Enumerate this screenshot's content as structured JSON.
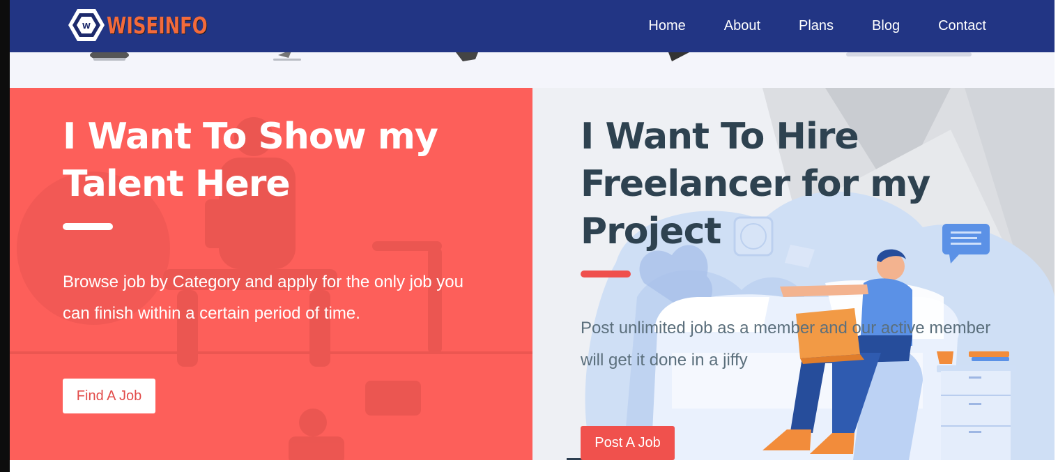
{
  "brand": {
    "logo_text": "WISEINFO",
    "accent_color": "#f36a3b",
    "header_color": "#223584"
  },
  "nav": {
    "items": [
      {
        "label": "Home"
      },
      {
        "label": "About"
      },
      {
        "label": "Plans"
      },
      {
        "label": "Blog"
      },
      {
        "label": "Contact"
      }
    ]
  },
  "talent": {
    "heading": "I Want To Show my Talent Here",
    "description": "Browse job by Category and apply for the only job you can finish within a certain period of time.",
    "button_label": "Find A Job",
    "panel_color": "#fd5f5a"
  },
  "hire": {
    "heading": "I Want To Hire Freelancer for my Project",
    "description": "Post unlimited job as a member and our active member will get it done in a jiffy",
    "button_label": "Post A Job",
    "panel_color": "#eef0f4"
  }
}
